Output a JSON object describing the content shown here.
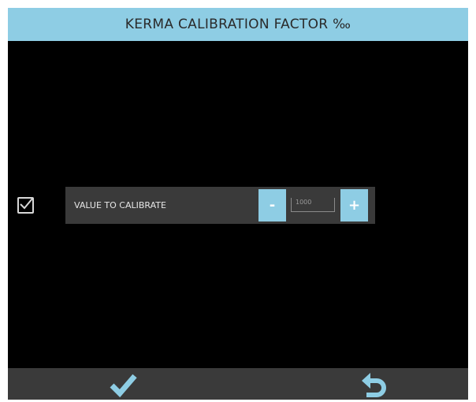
{
  "title": "KERMA CALIBRATION FACTOR ‰",
  "setting": {
    "enabled": true,
    "label": "VALUE TO CALIBRATE",
    "value": "1000",
    "minus_label": "-",
    "plus_label": "+"
  },
  "footer": {
    "confirm_icon": "checkmark-icon",
    "back_icon": "undo-arrow-icon"
  },
  "colors": {
    "accent": "#8ecde4",
    "background": "#000000",
    "panel": "#3a3a3a"
  }
}
